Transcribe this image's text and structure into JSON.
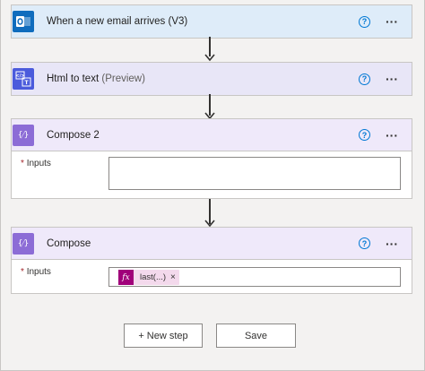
{
  "colors": {
    "outlook_blue": "#0f6cbd",
    "html_blue": "#4b5bdc",
    "compose_purple": "#8c6cd6",
    "trigger_header_bg": "#deecf9",
    "action_header_bg": "#e8e6f7",
    "compose_header_bg": "#efe9fa",
    "expression_token": "#a0007a"
  },
  "steps": [
    {
      "title": "When a new email arrives (V3)",
      "suffix": "",
      "icon": "outlook-icon",
      "icon_text": "O"
    },
    {
      "title": "Html to text",
      "suffix": "(Preview)",
      "icon": "html-to-text-icon",
      "icon_text": "</>"
    },
    {
      "title": "Compose 2",
      "suffix": "",
      "icon": "compose-icon",
      "icon_text": "{⁄}",
      "field": {
        "required": "*",
        "label": "Inputs",
        "value": ""
      }
    },
    {
      "title": "Compose",
      "suffix": "",
      "icon": "compose-icon",
      "icon_text": "{⁄}",
      "field": {
        "required": "*",
        "label": "Inputs",
        "token": {
          "icon": "fx",
          "text": "last(...)",
          "remove": "×"
        }
      }
    }
  ],
  "help_glyph": "?",
  "more_glyph": "···",
  "footer": {
    "new_step": "+ New step",
    "save": "Save"
  }
}
